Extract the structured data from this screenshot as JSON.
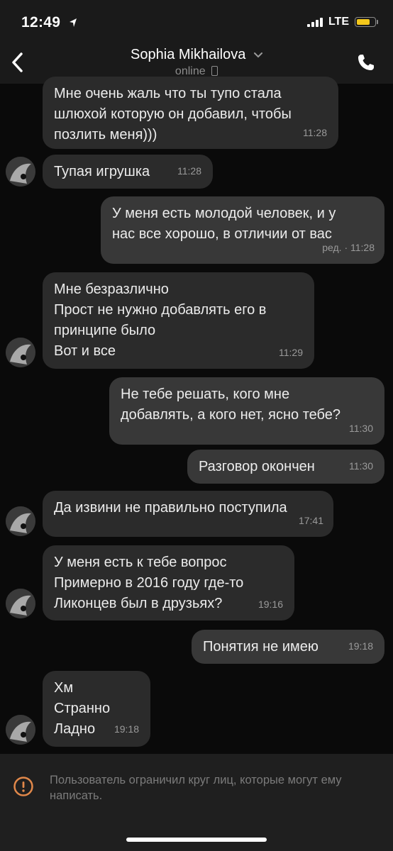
{
  "status_bar": {
    "time": "12:49",
    "network": "LTE",
    "battery_color": "#f4c81b",
    "location_icon": "location-arrow-icon"
  },
  "header": {
    "contact_name": "Sophia Mikhailova",
    "status": "online",
    "back_icon": "chevron-left-icon",
    "call_icon": "phone-icon"
  },
  "messages": [
    {
      "direction": "in",
      "text": "Мне очень жаль что ты тупо стала\nшлюхой которую он добавил, чтобы\nпозлить меня)))",
      "time": "11:28"
    },
    {
      "direction": "in",
      "text": "Тупая игрушка",
      "time": "11:28"
    },
    {
      "direction": "out",
      "text": "У меня есть молодой человек, и у\nнас все хорошо, в отличии от вас",
      "time": "ред. · 11:28"
    },
    {
      "direction": "in",
      "text": "Мне безразлично\nПрост не нужно добавлять его в\nпринципе было\nВот и все",
      "time": "11:29"
    },
    {
      "direction": "out",
      "text": "Не тебе решать, кого мне\nдобавлять, а кого нет, ясно тебе?",
      "time": "11:30"
    },
    {
      "direction": "out",
      "text": "Разговор окончен",
      "time": "11:30"
    },
    {
      "direction": "in",
      "text": "Да извини не правильно поступила",
      "time": "17:41"
    },
    {
      "direction": "in",
      "text": "У меня есть к тебе вопрос\nПримерно в 2016 году где-то\nЛиконцев был в друзьях?",
      "time": "19:16"
    },
    {
      "direction": "out",
      "text": "Понятия не имею",
      "time": "19:18"
    },
    {
      "direction": "in",
      "text": "Хм\nСтранно\nЛадно",
      "time": "19:18"
    }
  ],
  "footer": {
    "notice": "Пользователь ограничил круг лиц, которые могут ему написать.",
    "icon": "warning-icon",
    "accent": "#e1884a"
  }
}
